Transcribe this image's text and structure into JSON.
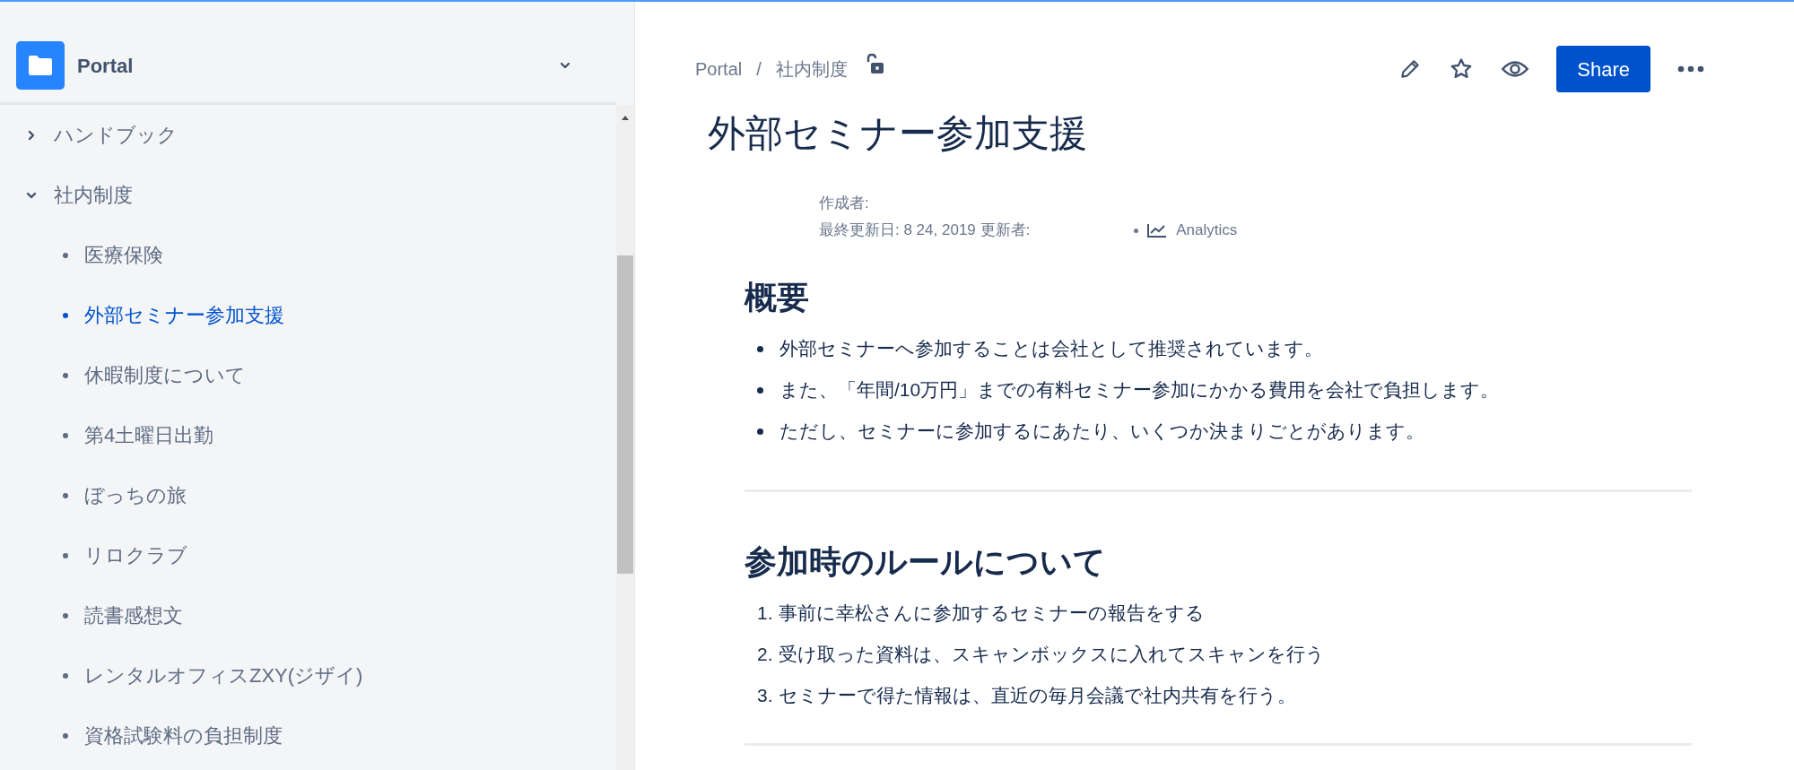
{
  "sidebar": {
    "space": {
      "title": "Portal"
    },
    "items": [
      {
        "label": "ハンドブック",
        "expanded": false
      },
      {
        "label": "社内制度",
        "expanded": true,
        "children": [
          {
            "label": "医療保険",
            "selected": false
          },
          {
            "label": "外部セミナー参加支援",
            "selected": true
          },
          {
            "label": "休暇制度について",
            "selected": false
          },
          {
            "label": "第4土曜日出勤",
            "selected": false
          },
          {
            "label": "ぼっちの旅",
            "selected": false
          },
          {
            "label": "リロクラブ",
            "selected": false
          },
          {
            "label": "読書感想文",
            "selected": false
          },
          {
            "label": "レンタルオフィスZXY(ジザイ)",
            "selected": false
          },
          {
            "label": "資格試験料の負担制度",
            "selected": false
          }
        ]
      }
    ]
  },
  "breadcrumbs": [
    "Portal",
    "社内制度"
  ],
  "breadcrumb_separator": "/",
  "actions": {
    "share": "Share"
  },
  "page": {
    "title": "外部セミナー参加支援",
    "created_by": "作成者:",
    "last_updated": "最終更新日: 8 24, 2019 更新者:",
    "analytics": "Analytics",
    "sections": [
      {
        "heading": "概要",
        "kind": "bullets",
        "items": [
          {
            "text": "外部セミナーへ参加することは会社として推奨されています。"
          },
          {
            "text": "また、「年間/10万円」までの有料セミナー参加にかかる費用を会社で負担します。"
          },
          {
            "text": "ただし、セミナーに参加するにあたり、いくつか決まりごとがあります。"
          }
        ]
      },
      {
        "heading": "参加時のルールについて",
        "kind": "numbered",
        "items": [
          {
            "number": "1.",
            "text": "事前に幸松さんに参加するセミナーの報告をする"
          },
          {
            "number": "2.",
            "text": "受け取った資料は、スキャンボックスに入れてスキャンを行う"
          },
          {
            "number": "3.",
            "text": "セミナーで得た情報は、直近の毎月会議で社内共有を行う。"
          }
        ]
      }
    ]
  }
}
